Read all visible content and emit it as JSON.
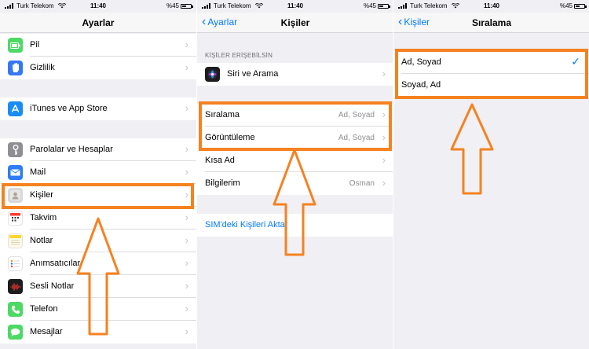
{
  "status": {
    "carrier": "Turk Telekom",
    "time": "11:40",
    "battery": "%45"
  },
  "panel1": {
    "title": "Ayarlar",
    "rows": [
      {
        "label": "Pil",
        "icon": "battery-icon",
        "color": "#4cd964"
      },
      {
        "label": "Gizlilik",
        "icon": "hand-icon",
        "color": "#3478f6"
      },
      {
        "label": "iTunes ve App Store",
        "icon": "app-store-icon",
        "color": "#1a8cf7"
      },
      {
        "label": "Parolalar ve Hesaplar",
        "icon": "key-icon",
        "color": "#8e8e93"
      },
      {
        "label": "Mail",
        "icon": "mail-icon",
        "color": "#2e7cf6"
      },
      {
        "label": "Kişiler",
        "icon": "contacts-icon",
        "color": "#c9c9ce"
      },
      {
        "label": "Takvim",
        "icon": "calendar-icon",
        "color": "#ffffff"
      },
      {
        "label": "Notlar",
        "icon": "notes-icon",
        "color": "#ffd52e"
      },
      {
        "label": "Anımsatıcılar",
        "icon": "reminders-icon",
        "color": "#ffffff"
      },
      {
        "label": "Sesli Notlar",
        "icon": "voice-memos-icon",
        "color": "#1c1c1e"
      },
      {
        "label": "Telefon",
        "icon": "phone-icon",
        "color": "#4cd964"
      },
      {
        "label": "Mesajlar",
        "icon": "messages-icon",
        "color": "#4cd964"
      }
    ]
  },
  "panel2": {
    "back": "Ayarlar",
    "title": "Kişiler",
    "section": "KİŞİLER ERİŞEBİLSİN",
    "siri": "Siri ve Arama",
    "rows": [
      {
        "label": "Sıralama",
        "value": "Ad, Soyad"
      },
      {
        "label": "Görüntüleme",
        "value": "Ad, Soyad"
      },
      {
        "label": "Kısa Ad",
        "value": ""
      },
      {
        "label": "Bilgilerim",
        "value": "Osman"
      }
    ],
    "sim": "SIM'deki Kişileri Aktar"
  },
  "panel3": {
    "back": "Kişiler",
    "title": "Sıralama",
    "options": [
      {
        "label": "Ad, Soyad",
        "selected": true
      },
      {
        "label": "Soyad, Ad",
        "selected": false
      }
    ]
  },
  "colors": {
    "accent": "#007aff",
    "highlight": "#f58220"
  }
}
